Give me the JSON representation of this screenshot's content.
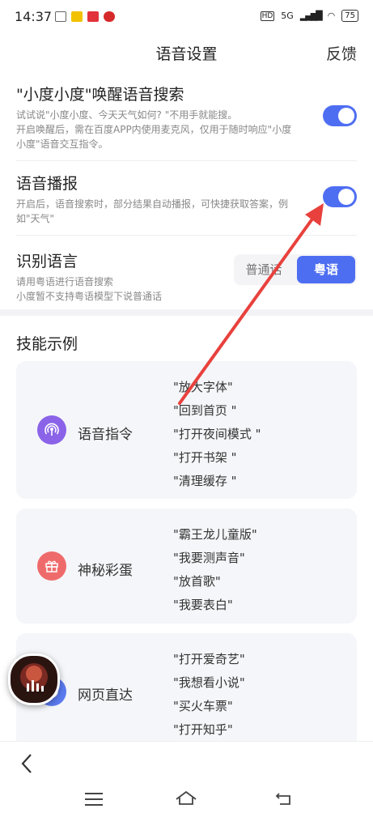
{
  "status": {
    "time": "14:37",
    "network": "5G",
    "battery": "75"
  },
  "nav": {
    "title": "语音设置",
    "feedback": "反馈"
  },
  "wake": {
    "title": "\"小度小度\"唤醒语音搜索",
    "desc1": "试试说\"小度小度、今天天气如何? \"不用手就能搜。",
    "desc2": "开启唤醒后，需在百度APP内使用麦克风，仅用于随时响应\"小度",
    "desc3": "小度\"语音交互指令。",
    "enabled": true
  },
  "broadcast": {
    "title": "语音播报",
    "desc1": "开启后，语音搜索时，部分结果自动播报，可快捷获取答案，例",
    "desc2": "如\"天气\"",
    "enabled": true
  },
  "language": {
    "title": "识别语言",
    "desc1": "请用粤语进行语音搜索",
    "desc2": "小度暂不支持粤语模型下说普通话",
    "options": [
      "普通话",
      "粤语"
    ],
    "selected": "粤语"
  },
  "skills": {
    "title": "技能示例",
    "cards": [
      {
        "name": "语音指令",
        "icon": "podcast-icon",
        "color": "#8a63e8",
        "items": [
          "\"放大字体\"",
          "\"回到首页 \"",
          "\"打开夜间模式 \"",
          "\"打开书架 \"",
          "\"清理缓存 \""
        ]
      },
      {
        "name": "神秘彩蛋",
        "icon": "gift-icon",
        "color": "#ef6b6b",
        "items": [
          "\"霸王龙儿童版\"",
          "\"我要测声音\"",
          "\"放首歌\"",
          "\"我要表白\""
        ]
      },
      {
        "name": "网页直达",
        "icon": "globe-icon",
        "color": "#5b7bef",
        "items": [
          "\"打开爱奇艺\"",
          "\"我想看小说\"",
          "\"买火车票\"",
          "\"打开知乎\""
        ]
      }
    ]
  },
  "annotation": {
    "color": "#e8413d"
  }
}
